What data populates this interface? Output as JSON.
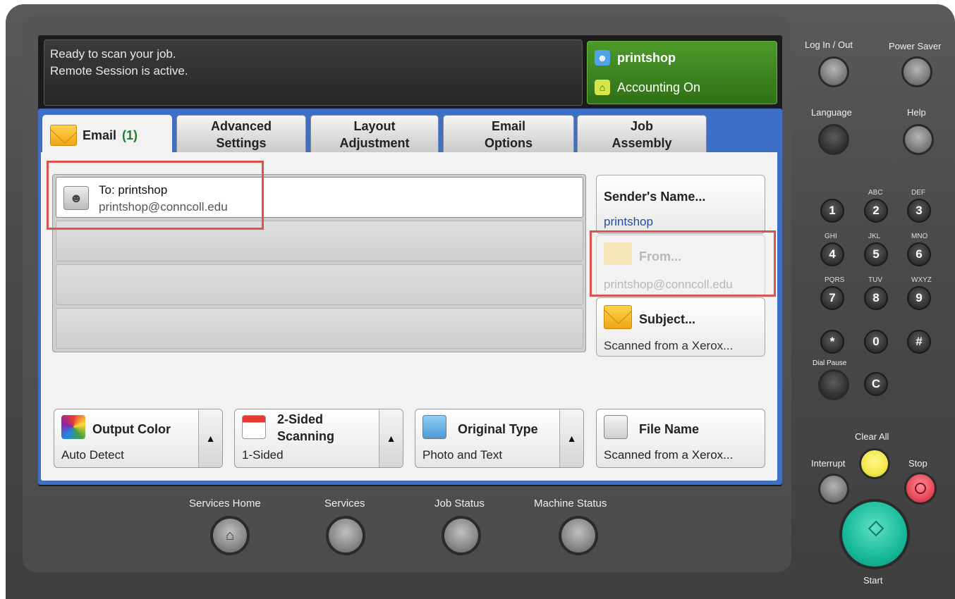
{
  "status": {
    "line1": "Ready to scan your job.",
    "line2": "Remote Session is active."
  },
  "user": {
    "name": "printshop",
    "accounting": "Accounting On",
    "user_icon": "user-icon",
    "accounting_icon": "bank-icon"
  },
  "tabs": [
    {
      "label": "Email",
      "count": "(1)"
    },
    {
      "label": "Advanced\nSettings"
    },
    {
      "label": "Layout\nAdjustment"
    },
    {
      "label": "Email\nOptions"
    },
    {
      "label": "Job\nAssembly"
    }
  ],
  "recipient": {
    "to": "To: printshop",
    "address": "printshop@conncoll.edu"
  },
  "sender": {
    "title": "Sender's Name...",
    "value": "printshop"
  },
  "from": {
    "title": "From...",
    "value": "printshop@conncoll.edu"
  },
  "subject": {
    "title": "Subject...",
    "value": "Scanned from a Xerox..."
  },
  "features": {
    "output_color": {
      "title": "Output Color",
      "value": "Auto Detect"
    },
    "two_sided": {
      "title_line1": "2-Sided",
      "title_line2": "Scanning",
      "value": "1-Sided"
    },
    "original_type": {
      "title": "Original Type",
      "value": "Photo and Text"
    },
    "file_name": {
      "title": "File Name",
      "value": "Scanned from a Xerox..."
    }
  },
  "hardware": {
    "login": "Log In / Out",
    "power_saver": "Power Saver",
    "language": "Language",
    "help": "Help",
    "keys": [
      {
        "k": "1",
        "sub": ""
      },
      {
        "k": "2",
        "sub": "ABC"
      },
      {
        "k": "3",
        "sub": "DEF"
      },
      {
        "k": "4",
        "sub": "GHI"
      },
      {
        "k": "5",
        "sub": "JKL"
      },
      {
        "k": "6",
        "sub": "MNO"
      },
      {
        "k": "7",
        "sub": "PQRS"
      },
      {
        "k": "8",
        "sub": "TUV"
      },
      {
        "k": "9",
        "sub": "WXYZ"
      },
      {
        "k": "*",
        "sub": ""
      },
      {
        "k": "0",
        "sub": ""
      },
      {
        "k": "#",
        "sub": ""
      }
    ],
    "dial_pause": "Dial Pause",
    "c_key": "C",
    "clear_all": "Clear All",
    "interrupt": "Interrupt",
    "stop": "Stop",
    "start": "Start",
    "colors": {
      "clear_all": "#f2e84a",
      "stop": "#e84a5a",
      "start": "#17b99a",
      "accent": "#3f6fc4",
      "user_box": "#3a8a20"
    }
  },
  "nav": {
    "services_home": "Services Home",
    "services": "Services",
    "job_status": "Job Status",
    "machine_status": "Machine Status"
  }
}
